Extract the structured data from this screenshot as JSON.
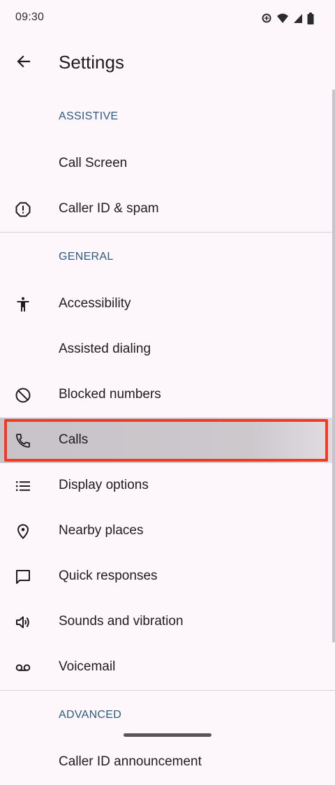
{
  "status_bar": {
    "time": "09:30",
    "icons": [
      "data-saver-icon",
      "wifi-icon",
      "cell-signal-icon",
      "battery-icon"
    ]
  },
  "app_bar": {
    "back_icon": "arrow-back-icon",
    "title": "Settings"
  },
  "sections": {
    "assistive": {
      "header": "ASSISTIVE",
      "items": [
        {
          "label": "Call Screen",
          "icon": null
        },
        {
          "label": "Caller ID & spam",
          "icon": "alert-octagon-icon"
        }
      ]
    },
    "general": {
      "header": "GENERAL",
      "items": [
        {
          "label": "Accessibility",
          "icon": "accessibility-icon"
        },
        {
          "label": "Assisted dialing",
          "icon": null
        },
        {
          "label": "Blocked numbers",
          "icon": "block-icon"
        },
        {
          "label": "Calls",
          "icon": "phone-icon",
          "highlighted": true
        },
        {
          "label": "Display options",
          "icon": "list-icon"
        },
        {
          "label": "Nearby places",
          "icon": "location-pin-icon"
        },
        {
          "label": "Quick responses",
          "icon": "chat-bubble-icon"
        },
        {
          "label": "Sounds and vibration",
          "icon": "volume-icon"
        },
        {
          "label": "Voicemail",
          "icon": "voicemail-icon"
        }
      ]
    },
    "advanced": {
      "header": "ADVANCED",
      "items": [
        {
          "label": "Caller ID announcement",
          "icon": null
        }
      ]
    }
  },
  "colors": {
    "background": "#fdf7fb",
    "section_header": "#2f5a80",
    "highlight_border": "#f43a22",
    "highlight_fill": "#c8c3c8"
  }
}
